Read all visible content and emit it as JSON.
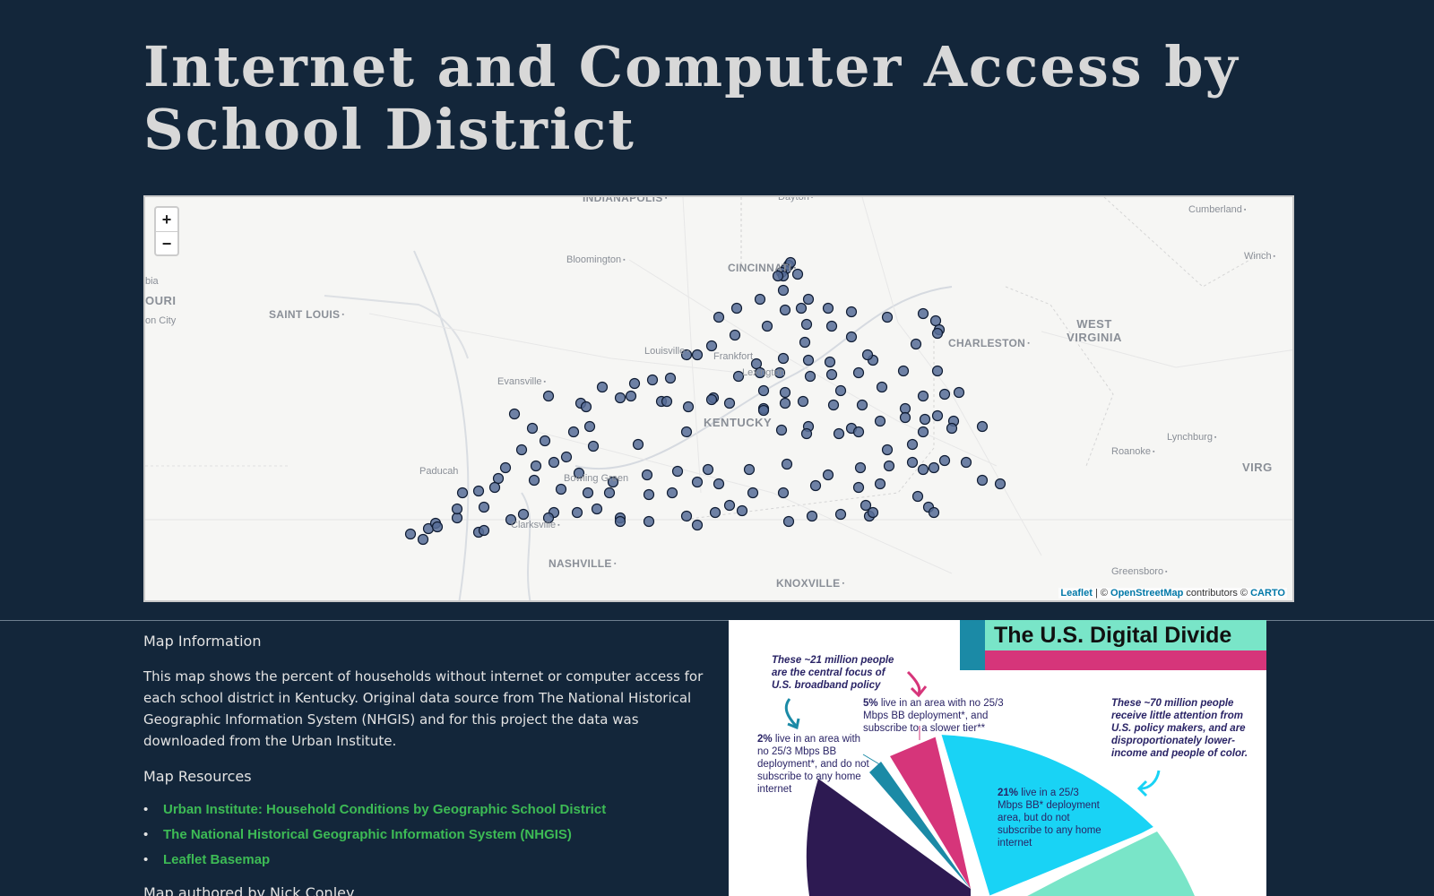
{
  "page": {
    "title": "Internet and Computer Access by School District"
  },
  "map": {
    "zoom_in": "+",
    "zoom_out": "−",
    "place_labels": [
      {
        "text": "INDIANAPOLIS",
        "style": "md"
      },
      {
        "text": "Dayton",
        "style": "sm"
      },
      {
        "text": "Cumberland",
        "style": "sm"
      },
      {
        "text": "Bloomington",
        "style": "sm"
      },
      {
        "text": "CINCINNATI",
        "style": "md"
      },
      {
        "text": "Winch",
        "style": "sm"
      },
      {
        "text": "bia",
        "style": "sm"
      },
      {
        "text": "OURI",
        "style": "lg"
      },
      {
        "text": "SAINT LOUIS",
        "style": "md"
      },
      {
        "text": "on City",
        "style": "sm"
      },
      {
        "text": "WEST VIRGINIA",
        "style": "lg"
      },
      {
        "text": "CHARLESTON",
        "style": "md"
      },
      {
        "text": "Louisville",
        "style": "sm"
      },
      {
        "text": "Frankfort",
        "style": "sm"
      },
      {
        "text": "Lexington",
        "style": "sm"
      },
      {
        "text": "Evansville",
        "style": "sm"
      },
      {
        "text": "KENTUCKY",
        "style": "lg"
      },
      {
        "text": "Roanoke",
        "style": "sm"
      },
      {
        "text": "Lynchburg",
        "style": "sm"
      },
      {
        "text": "Paducah",
        "style": "sm"
      },
      {
        "text": "Bowling Green",
        "style": "sm"
      },
      {
        "text": "VIRG",
        "style": "lg"
      },
      {
        "text": "Clarksville",
        "style": "sm"
      },
      {
        "text": "NASHVILLE",
        "style": "md"
      },
      {
        "text": "Greensboro",
        "style": "sm"
      },
      {
        "text": "KNOXVILLE",
        "style": "md"
      }
    ],
    "attribution": {
      "leaflet": "Leaflet",
      "sep": " | © ",
      "osm": "OpenStreetMap",
      "contrib": " contributors © ",
      "carto": "CARTO"
    }
  },
  "info": {
    "heading": "Map Information",
    "description": "This map shows the percent of households without internet or computer access for each school district in Kentucky. Original data source from The National Historical Geographic Information System (NHGIS) and for this project the data was downloaded from the Urban Institute.",
    "resources_heading": "Map Resources",
    "resources": [
      "Urban Institute: Household Conditions by Geographic School District",
      "The National Historical Geographic Information System (NHGIS)",
      "Leaflet Basemap"
    ],
    "author": "Map authored by Nick Conley"
  },
  "infographic": {
    "title": "The U.S. Digital Divide",
    "focus_note": "These ~21 million people are the central focus of U.S. broadband policy",
    "pct_5": "5%",
    "text_5": " live in an area with no 25/3 Mbps BB deployment*, and subscribe to a slower tier**",
    "pct_2": "2%",
    "text_2": " live in an area with no 25/3 Mbps BB deployment*, and do not subscribe to any home internet",
    "pct_21": "21%",
    "text_21": " live in a 25/3 Mbps BB* deployment area, but do not subscribe to any home internet",
    "note_70": "These ~70 million people receive little attention from U.S. policy makers, and are disproportionately lower-income and people of color.",
    "colors": {
      "pink": "#d6357a",
      "mint": "#79e5c8",
      "cyan": "#19d3f5",
      "purple": "#2d1a52",
      "teal": "#1b8aa6"
    }
  }
}
